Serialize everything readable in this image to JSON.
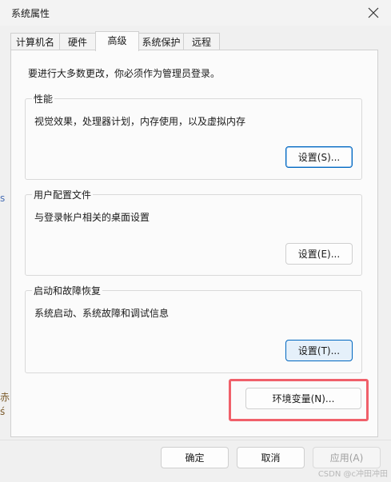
{
  "window": {
    "title": "系统属性"
  },
  "tabs": [
    {
      "label": "计算机名"
    },
    {
      "label": "硬件"
    },
    {
      "label": "高级"
    },
    {
      "label": "系统保护"
    },
    {
      "label": "远程"
    }
  ],
  "active_tab": "高级",
  "panel": {
    "notice": "要进行大多数更改，你必须作为管理员登录。",
    "groups": [
      {
        "title": "性能",
        "desc": "视觉效果，处理器计划，内存使用，以及虚拟内存",
        "button": "设置(S)..."
      },
      {
        "title": "用户配置文件",
        "desc": "与登录帐户相关的桌面设置",
        "button": "设置(E)..."
      },
      {
        "title": "启动和故障恢复",
        "desc": "系统启动、系统故障和调试信息",
        "button": "设置(T)..."
      }
    ],
    "env_button": "环境变量(N)..."
  },
  "footer": {
    "ok": "确定",
    "cancel": "取消",
    "apply": "应用(A)"
  },
  "watermark": "CSDN @c冲田冲田",
  "colors": {
    "accent": "#0067c0",
    "highlight": "#f0606a"
  },
  "icons": {
    "close": "close-icon"
  }
}
